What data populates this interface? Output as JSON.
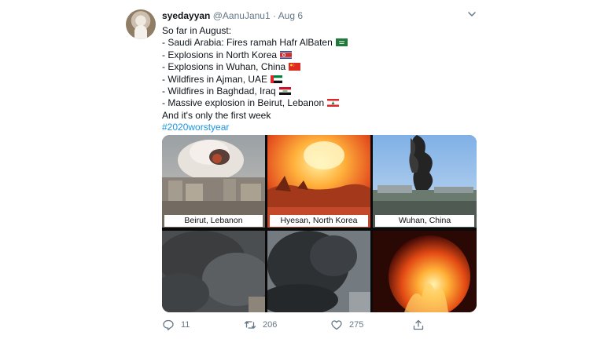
{
  "tweet": {
    "display_name": "syedayyan",
    "handle": "@AanuJanu1",
    "separator": "·",
    "date": "Aug 6",
    "lines": [
      "So far in August:",
      "- Saudi Arabia: Fires ramah Hafr AlBaten",
      "- Explosions in North Korea",
      "- Explosions in Wuhan, China",
      "- Wildfires in Ajman, UAE",
      "- Wildfires in Baghdad, Iraq",
      "- Massive explosion in Beirut, Lebanon",
      "And it's only the first week"
    ],
    "hashtag": "#2020worstyear",
    "flags": [
      "saudi-arabia-flag",
      "north-korea-flag",
      "china-flag",
      "uae-flag",
      "iraq-flag",
      "lebanon-flag"
    ]
  },
  "media": {
    "captions": [
      "Beirut, Lebanon",
      "Hyesan, North Korea",
      "Wuhan, China"
    ]
  },
  "actions": {
    "reply_count": "11",
    "retweet_count": "206",
    "like_count": "275"
  },
  "colors": {
    "link": "#1b95e0",
    "muted": "#657786",
    "text": "#0f1419"
  }
}
